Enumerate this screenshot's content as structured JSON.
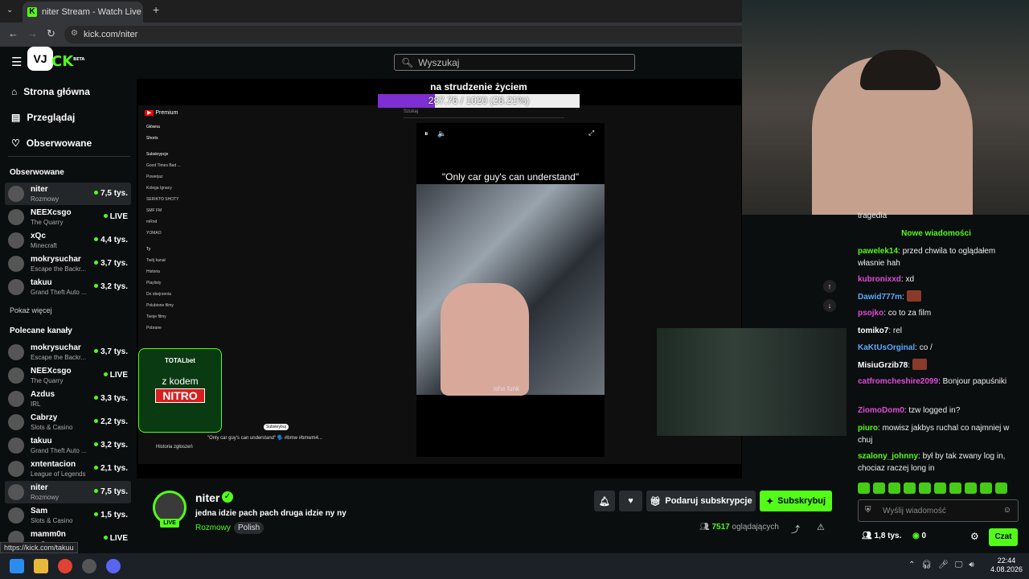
{
  "browser": {
    "tab_title": "niter Stream - Watch Live o",
    "url": "kick.com/niter",
    "status_url": "https://kick.com/takuu"
  },
  "header": {
    "search_placeholder": "Wyszukaj",
    "logo_text": "CK",
    "beta": "BETA"
  },
  "sidebar": {
    "nav": [
      {
        "label": "Strona główna",
        "icon": "home-icon"
      },
      {
        "label": "Przeglądaj",
        "icon": "browse-icon"
      },
      {
        "label": "Obserwowane",
        "icon": "heart-icon"
      }
    ],
    "followed_title": "Obserwowane",
    "followed": [
      {
        "name": "niter",
        "category": "Rozmowy",
        "viewers": "7,5 tys."
      },
      {
        "name": "NEEXcsgo",
        "category": "The Quarry",
        "viewers": "LIVE"
      },
      {
        "name": "xQc",
        "category": "Minecraft",
        "viewers": "4,4 tys."
      },
      {
        "name": "mokrysuchar",
        "category": "Escape the Backr...",
        "viewers": "3,7 tys."
      },
      {
        "name": "takuu",
        "category": "Grand Theft Auto ...",
        "viewers": "3,2 tys."
      }
    ],
    "show_more": "Pokaż więcej",
    "recommended_title": "Polecane kanały",
    "recommended": [
      {
        "name": "mokrysuchar",
        "category": "Escape the Backr...",
        "viewers": "3,7 tys."
      },
      {
        "name": "NEEXcsgo",
        "category": "The Quarry",
        "viewers": "LIVE"
      },
      {
        "name": "Azdus",
        "category": "IRL",
        "viewers": "3,3 tys."
      },
      {
        "name": "Cabrzy",
        "category": "Slots & Casino",
        "viewers": "2,2 tys."
      },
      {
        "name": "takuu",
        "category": "Grand Theft Auto ...",
        "viewers": "3,2 tys."
      },
      {
        "name": "xntentacion",
        "category": "League of Legends",
        "viewers": "2,1 tys."
      },
      {
        "name": "niter",
        "category": "Rozmowy",
        "viewers": "7,5 tys."
      },
      {
        "name": "Sam",
        "category": "Slots & Casino",
        "viewers": "1,5 tys."
      },
      {
        "name": "mamm0n",
        "category": "...e 2",
        "viewers": "LIVE"
      }
    ]
  },
  "overlay": {
    "goal_text": "na strudzenie życiem",
    "progress_text": "287.76 / 1020 (28.21%)",
    "progress_fraction": 0.2821,
    "short_caption": "\"Only car guy's can understand\"",
    "short_watermark": "ishe funk",
    "yt_logo": "Premium",
    "yt_search": "Szukaj",
    "yt_nav": [
      "Główna",
      "Shorts"
    ],
    "yt_subs_title": "Subskrypcje",
    "yt_subs": [
      "Good Times Bad ...",
      "Powerjaz",
      "Kolega Ignacy",
      "SERIKTO SHOTY",
      "SMF FM",
      "mRnd",
      "YOMAO"
    ],
    "yt_you_title": "Ty",
    "yt_you": [
      "Twój kanał",
      "Historia",
      "Playlisty",
      "Do obejrzenia",
      "Polubione filmy",
      "Twoje filmy",
      "Pobrane"
    ],
    "yt_history": "Historia zgłoszeń",
    "yt_video_title": "\"Only car guy's can understand\" 🗣️ #bmw #bmwm4...",
    "yt_subscribe": "Subskrybuj",
    "promo_brand": "TOTALbet",
    "promo_line1": "z kodem",
    "promo_line2": "NITRO"
  },
  "stream": {
    "name": "niter",
    "title": "jedna idzie pach pach druga idzie ny ny",
    "category": "Rozmowy",
    "tag": "Polish",
    "live": "LIVE",
    "gift_label": "Podaruj subskrypcje",
    "subscribe_label": "Subskrybuj",
    "viewers_count": "7517",
    "viewers_label": "oglądających"
  },
  "chat": {
    "new_messages": "Nowe wiadomości",
    "top_fragment": "tragedia",
    "messages": [
      {
        "user": "pawelek14",
        "color": "#53fc18",
        "text": "przed chwila to oglądałem własnie hah"
      },
      {
        "user": "kubronixxd",
        "color": "#e04bd8",
        "text": "xd"
      },
      {
        "user": "Dawid777m",
        "color": "#5aa9ff",
        "text": ""
      },
      {
        "user": "psojko",
        "color": "#e04bd8",
        "text": "co to za film"
      },
      {
        "user": "tomiko7",
        "color": "#ffffff",
        "text": "rel"
      },
      {
        "user": "KaKtUsOrginal",
        "color": "#5aa9ff",
        "text": "co /"
      },
      {
        "user": "MisiuGrzib78",
        "color": "#ffffff",
        "text": ""
      },
      {
        "user": "catfromcheshire2099",
        "color": "#e04bd8",
        "text": "Bonjour papuśniki"
      },
      {
        "user": "ZiomoDom0",
        "color": "#e04bd8",
        "text": "tzw logged in?"
      },
      {
        "user": "piuro",
        "color": "#53fc18",
        "text": "mowisz jakbys ruchal co najmniej w chuj"
      },
      {
        "user": "szalony_johnny",
        "color": "#53fc18",
        "text": "był by tak zwany log in, chociaz raczej long in"
      }
    ],
    "input_placeholder": "Wyślij wiadomość",
    "followers": "1,8 tys.",
    "points": "0",
    "send_label": "Czat"
  },
  "taskbar": {
    "time": "22:44",
    "date": "4.08.2026"
  }
}
